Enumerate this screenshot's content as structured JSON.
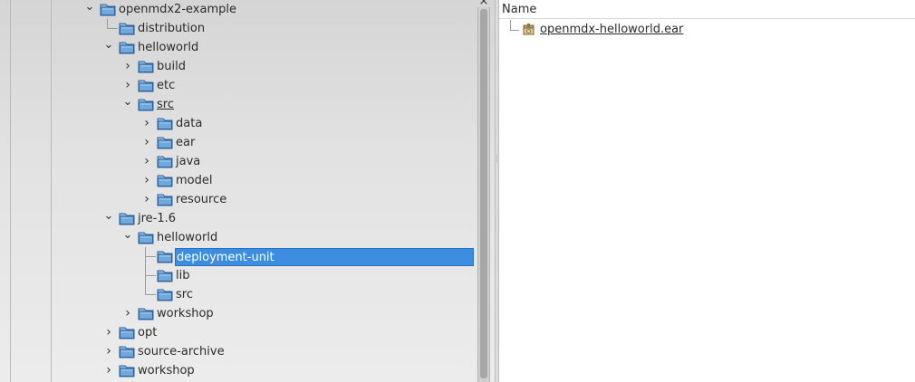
{
  "tree": {
    "nodes": [
      {
        "label": "openmdx2-example",
        "state": "expanded"
      },
      {
        "label": "distribution",
        "state": "leaf"
      },
      {
        "label": "helloworld",
        "state": "expanded"
      },
      {
        "label": "build",
        "state": "collapsed"
      },
      {
        "label": "etc",
        "state": "collapsed"
      },
      {
        "label": "src",
        "state": "expanded",
        "underlined": true
      },
      {
        "label": "data",
        "state": "collapsed"
      },
      {
        "label": "ear",
        "state": "collapsed"
      },
      {
        "label": "java",
        "state": "collapsed"
      },
      {
        "label": "model",
        "state": "collapsed"
      },
      {
        "label": "resource",
        "state": "collapsed"
      },
      {
        "label": "jre-1.6",
        "state": "expanded"
      },
      {
        "label": "helloworld",
        "state": "expanded"
      },
      {
        "label": "deployment-unit",
        "state": "leaf",
        "selected": true
      },
      {
        "label": "lib",
        "state": "leaf"
      },
      {
        "label": "src",
        "state": "leaf"
      },
      {
        "label": "workshop",
        "state": "collapsed"
      },
      {
        "label": "opt",
        "state": "collapsed"
      },
      {
        "label": "source-archive",
        "state": "collapsed"
      },
      {
        "label": "workshop",
        "state": "collapsed"
      }
    ]
  },
  "files": {
    "column_header": "Name",
    "items": [
      {
        "name": "openmdx-helloworld.ear",
        "icon": "ear-archive-icon"
      }
    ]
  },
  "colors": {
    "selection": "#3d8ee0",
    "folder_fill": "#6fa8dc",
    "folder_stroke": "#2f6399"
  }
}
